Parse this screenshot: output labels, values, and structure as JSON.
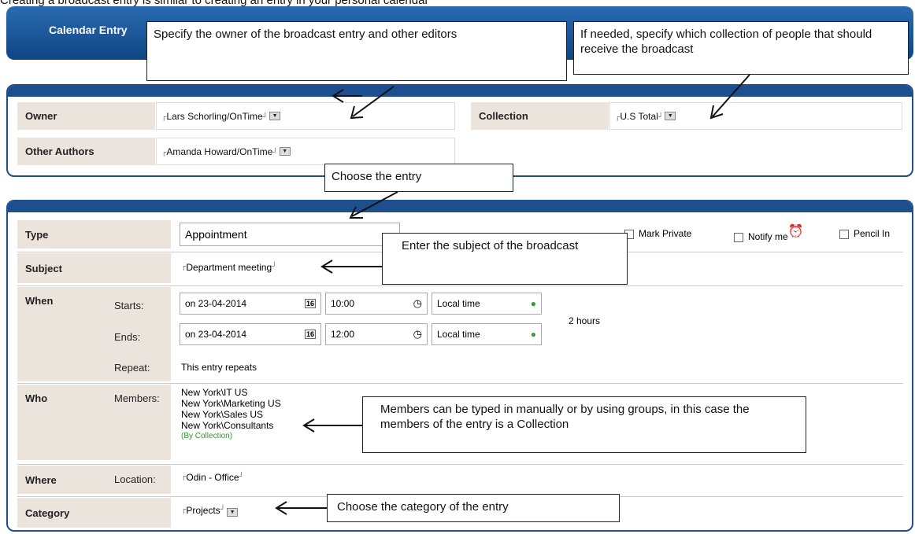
{
  "intro": "Creating a broadcast entry is similar to creating an entry in your personal calendar",
  "tab_title": "Calendar Entry",
  "callouts": {
    "owner": "Specify the owner of the broadcast entry and other editors",
    "collection": "If needed, specify which collection of people that should receive the broadcast",
    "type": "Choose the entry",
    "subject": "Enter the subject of the broadcast",
    "members": "Members can be typed in manually or by using groups, in this case the members of  the entry is a Collection",
    "category": "Choose the category of the entry"
  },
  "top_panel": {
    "owner_label": "Owner",
    "owner_value": "Lars Schorling/OnTime",
    "other_authors_label": "Other Authors",
    "other_authors_value": "Amanda Howard/OnTime",
    "collection_label": "Collection",
    "collection_value": "U.S Total"
  },
  "main_panel": {
    "type_label": "Type",
    "type_value": "Appointment",
    "mark_private": "Mark Private",
    "notify_me": "Notify me",
    "pencil_in": "Pencil In",
    "subject_label": "Subject",
    "subject_value": "Department meeting",
    "when_label": "When",
    "starts_label": "Starts:",
    "ends_label": "Ends:",
    "repeat_label": "Repeat:",
    "start_date": "on 23-04-2014",
    "start_time": "10:00",
    "end_date": "on 23-04-2014",
    "end_time": "12:00",
    "timezone_start": "Local time",
    "timezone_end": "Local time",
    "cal_icon_text": "16",
    "duration": "2 hours",
    "repeat_value": "This entry repeats",
    "who_label": "Who",
    "members_label": "Members:",
    "members": [
      "New York\\IT US",
      "New York\\Marketing US",
      "New York\\Sales US",
      "New York\\Consultants"
    ],
    "by_collection": "(By Collection)",
    "where_label": "Where",
    "location_label": "Location:",
    "location_value": "Odin - Office",
    "category_label": "Category",
    "category_value": "Projects"
  }
}
